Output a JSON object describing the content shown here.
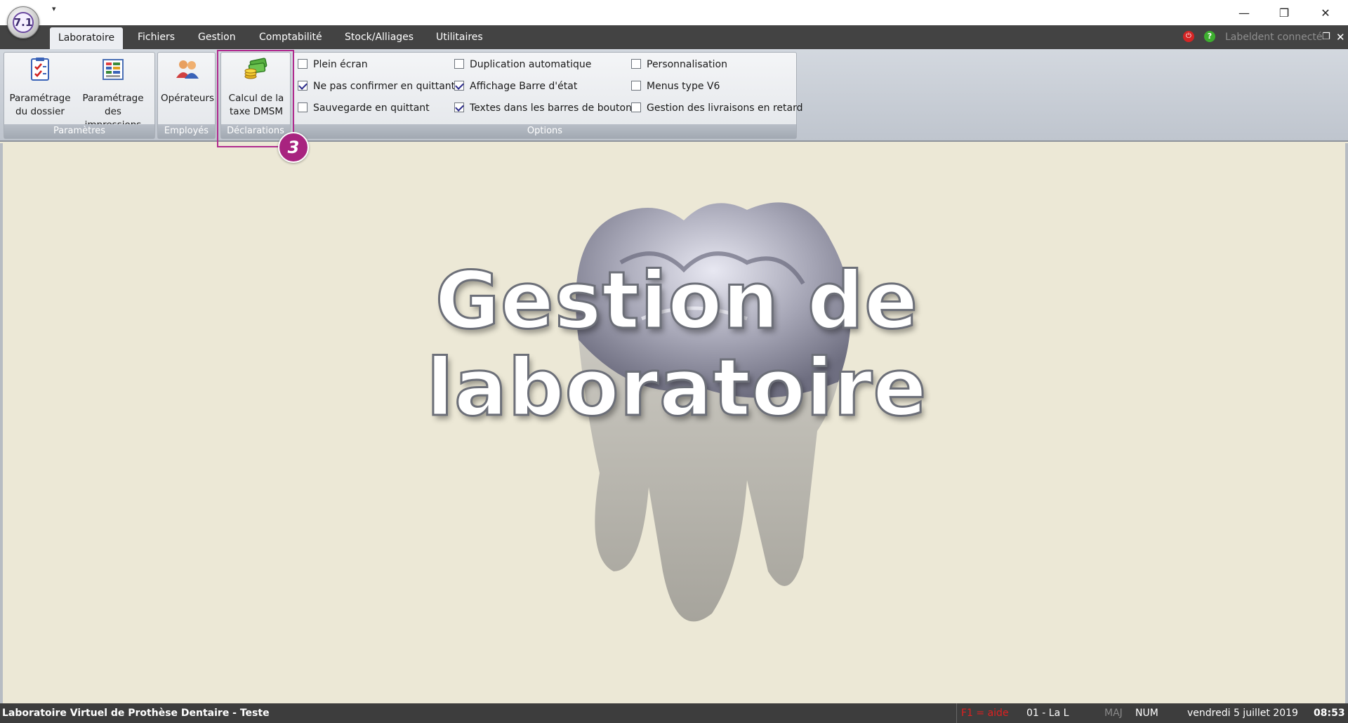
{
  "app": {
    "logo_text": "7.1",
    "qat_arrow": "▾",
    "window_buttons": {
      "minimize": "—",
      "maximize": "❐",
      "close": "✕"
    }
  },
  "tabs": [
    {
      "label": "Laboratoire",
      "active": true
    },
    {
      "label": "Fichiers",
      "active": false
    },
    {
      "label": "Gestion",
      "active": false
    },
    {
      "label": "Comptabilité",
      "active": false
    },
    {
      "label": "Stock/Alliages",
      "active": false
    },
    {
      "label": "Utilitaires",
      "active": false
    }
  ],
  "connection": {
    "status_text": "Labeldent connecté",
    "red_glyph": "⏻",
    "green_glyph": "?"
  },
  "ribbon": {
    "groups": {
      "parametres": {
        "label": "Paramètres",
        "buttons": [
          {
            "line1": "Paramétrage",
            "line2": "du dossier",
            "icon": "checklist-icon"
          },
          {
            "line1": "Paramétrage des",
            "line2": "impressions",
            "icon": "print-settings-icon"
          }
        ]
      },
      "employes": {
        "label": "Employés",
        "buttons": [
          {
            "line1": "Opérateurs",
            "line2": "",
            "icon": "users-icon"
          }
        ]
      },
      "declarations": {
        "label": "Déclarations",
        "buttons": [
          {
            "line1": "Calcul de la",
            "line2": "taxe DMSM",
            "icon": "money-icon"
          }
        ]
      },
      "options": {
        "label": "Options",
        "checkboxes": [
          {
            "label": "Plein écran",
            "checked": false
          },
          {
            "label": "Ne pas confirmer en quittant",
            "checked": true
          },
          {
            "label": "Sauvegarde en quittant",
            "checked": false
          },
          {
            "label": "Duplication automatique",
            "checked": false
          },
          {
            "label": "Affichage Barre d'état",
            "checked": true
          },
          {
            "label": "Textes dans les barres de boutons",
            "checked": true
          },
          {
            "label": "Personnalisation",
            "checked": false
          },
          {
            "label": "Menus type V6",
            "checked": false
          },
          {
            "label": "Gestion des livraisons en retard",
            "checked": false
          }
        ]
      }
    }
  },
  "annotation": {
    "step_number": "3"
  },
  "splash": {
    "line1": "Gestion de",
    "line2": "laboratoire"
  },
  "status": {
    "app_name": "Laboratoire Virtuel de Prothèse Dentaire - Teste",
    "help": "F1 = aide",
    "user": "01 - La L",
    "caps": "MAJ",
    "num": "NUM",
    "date": "vendredi 5 juillet 2019",
    "time": "08:53"
  },
  "colors": {
    "accent": "#a8237f",
    "tab_bar": "#434343",
    "status_bar": "#3d3d3d",
    "background": "#ece8d6",
    "help_text": "#e02020"
  }
}
